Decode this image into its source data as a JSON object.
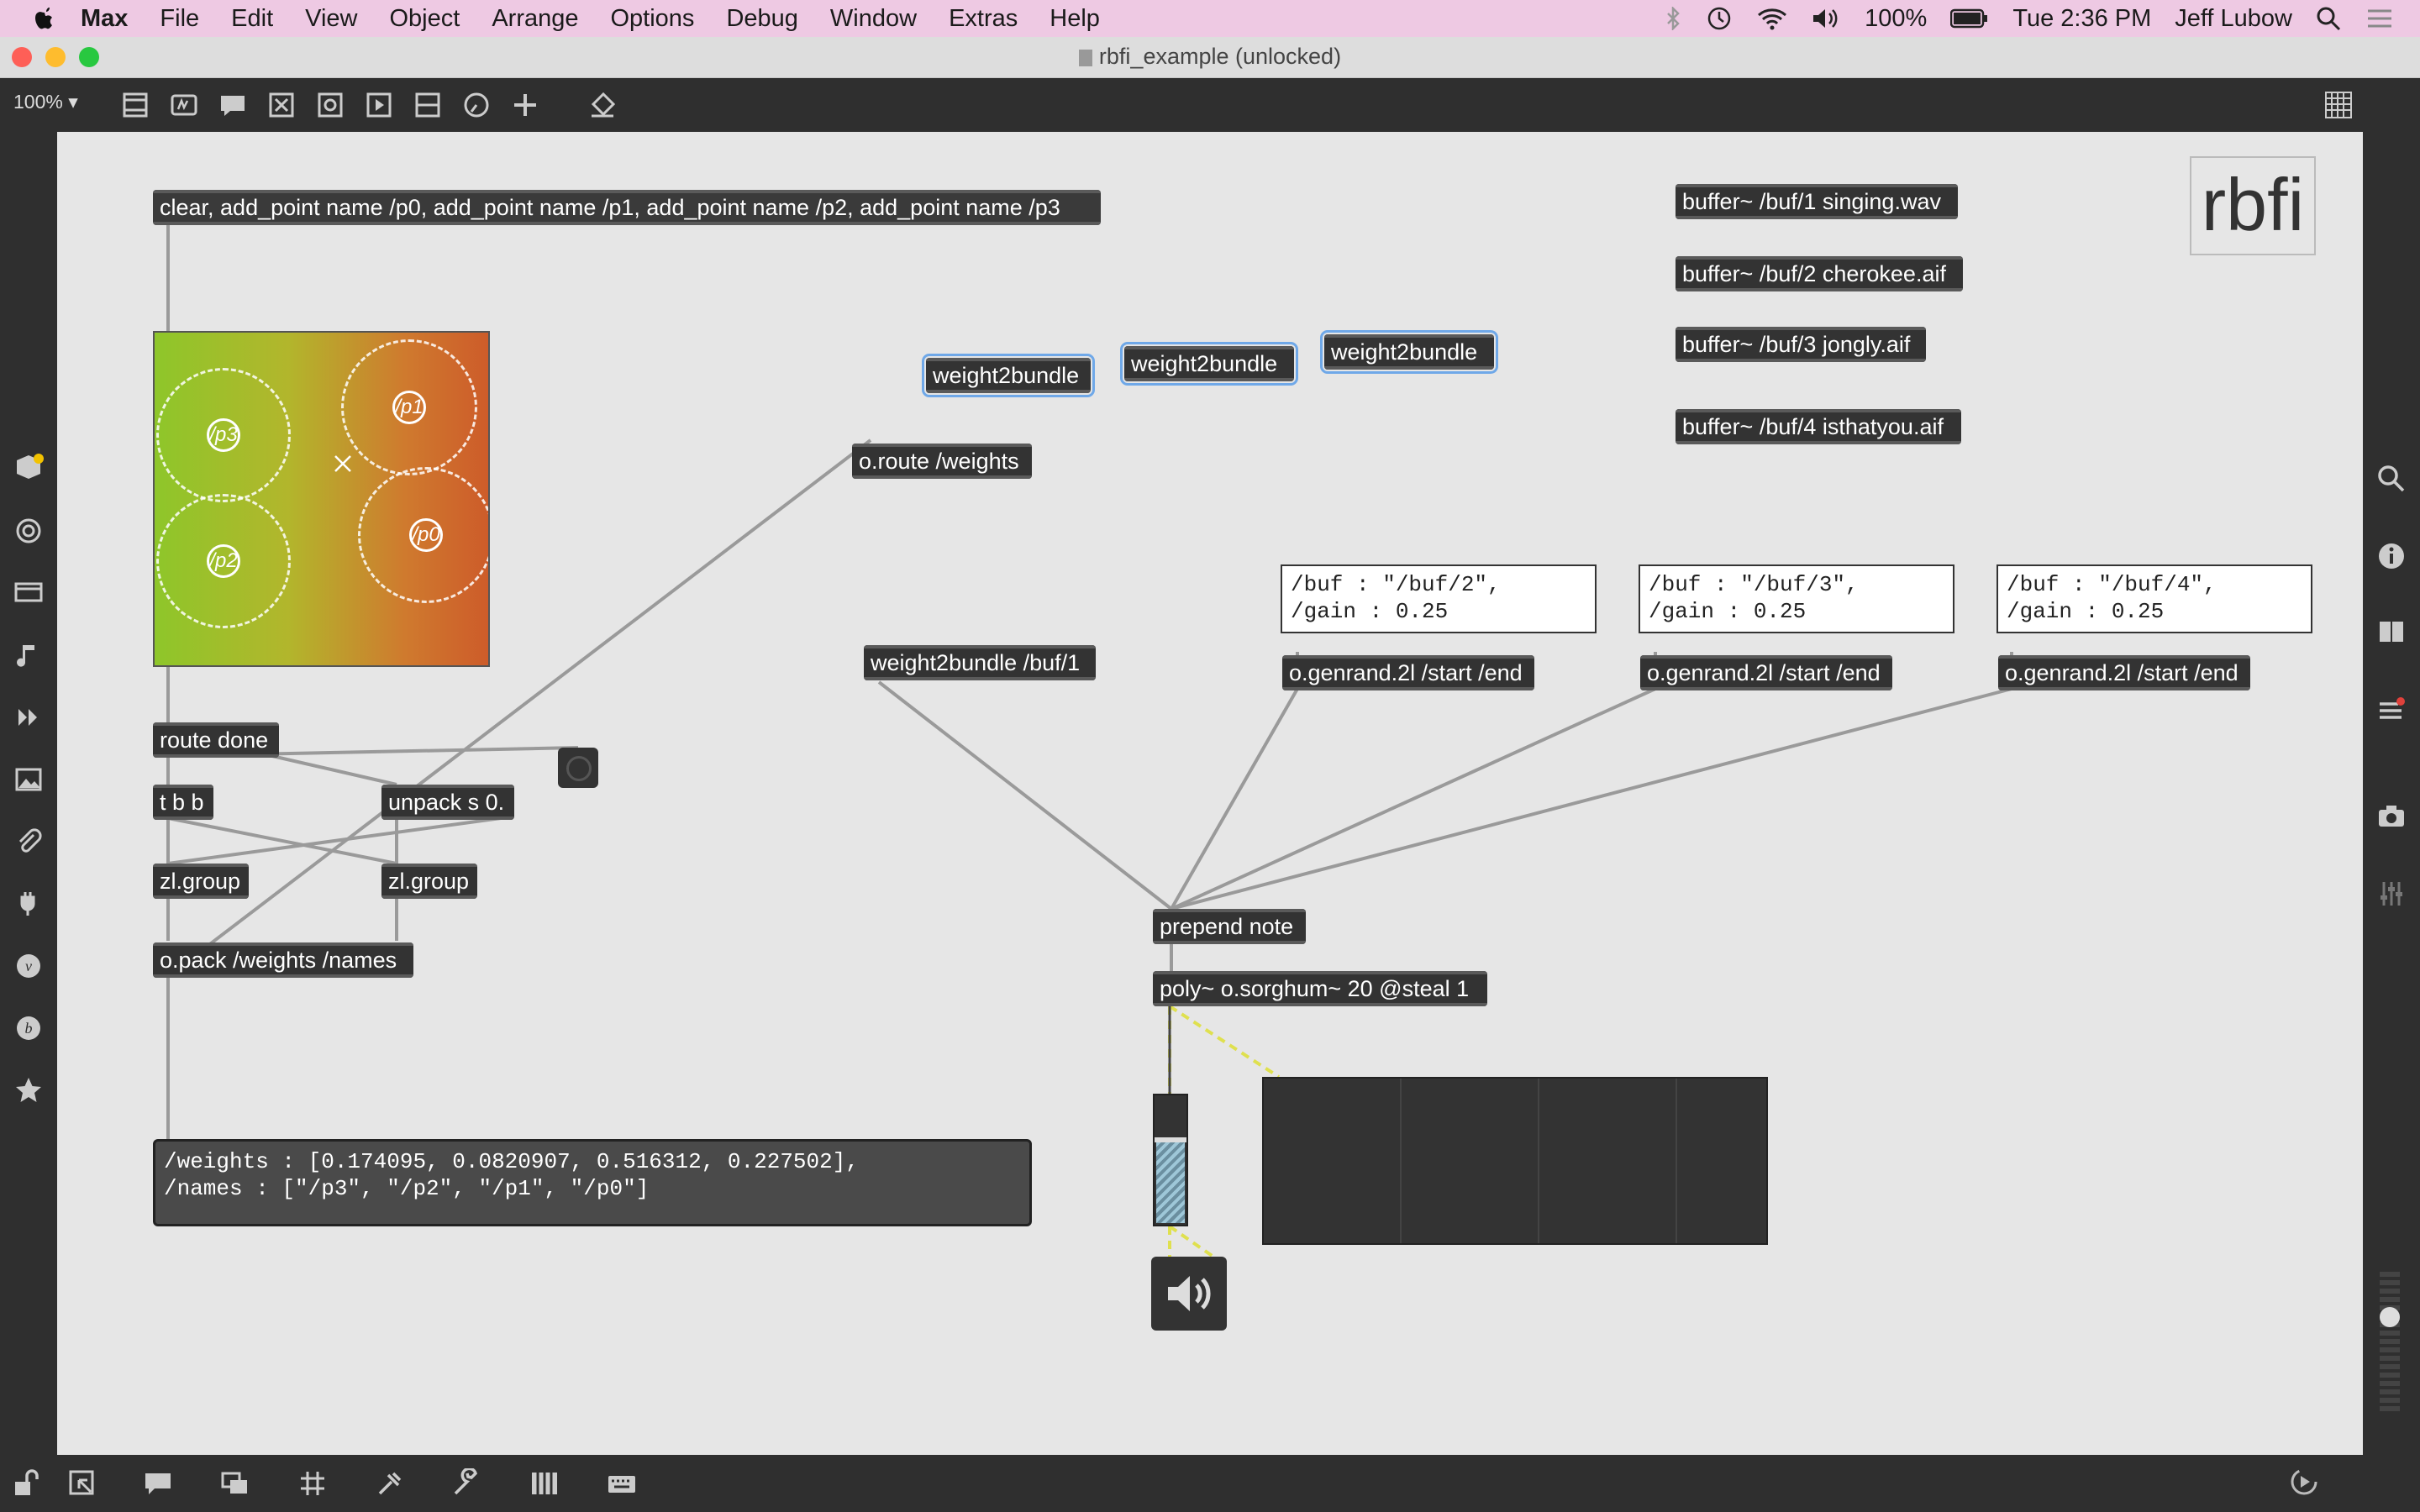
{
  "menubar": {
    "app": "Max",
    "items": [
      "File",
      "Edit",
      "View",
      "Object",
      "Arrange",
      "Options",
      "Debug",
      "Window",
      "Extras",
      "Help"
    ],
    "battery": "100%",
    "clock": "Tue 2:36 PM",
    "user": "Jeff Lubow"
  },
  "window": {
    "title": "rbfi_example (unlocked)",
    "zoom": "100%"
  },
  "patch": {
    "message_clear": "clear, add_point name /p0, add_point name /p1, add_point name /p2, add_point name /p3",
    "nodes": [
      "/p3",
      "/p1",
      "/p2",
      "/p0"
    ],
    "route_done": "route done",
    "tbb": "t b b",
    "unpack": "unpack s 0.",
    "zlgroup1": "zl.group",
    "zlgroup2": "zl.group",
    "opack": "o.pack /weights /names",
    "oroute": "o.route /weights",
    "w2b_1": "weight2bundle",
    "w2b_2": "weight2bundle",
    "w2b_3": "weight2bundle",
    "w2b_buf": "weight2bundle /buf/1",
    "buffers": [
      "buffer~ /buf/1 singing.wav",
      "buffer~ /buf/2 cherokee.aif",
      "buffer~ /buf/3 jongly.aif",
      "buffer~ /buf/4 isthatyou.aif"
    ],
    "rbfi_label": "rbfi",
    "comments": [
      "/buf : \"/buf/2\",\n/gain : 0.25",
      "/buf : \"/buf/3\",\n/gain : 0.25",
      "/buf : \"/buf/4\",\n/gain : 0.25"
    ],
    "genrand": [
      "o.genrand.2l /start /end",
      "o.genrand.2l /start /end",
      "o.genrand.2l /start /end"
    ],
    "prepend": "prepend note",
    "poly": "poly~ o.sorghum~ 20 @steal 1",
    "print_output": "/weights : [0.174095, 0.0820907, 0.516312, 0.227502],\n/names : [\"/p3\", \"/p2\", \"/p1\", \"/p0\"]"
  },
  "colors": {
    "menubar": "#eec9e3",
    "toolbar": "#2f2f2f",
    "canvas": "#e6e6e6",
    "object": "#333333",
    "selection": "#6fa8e8"
  }
}
